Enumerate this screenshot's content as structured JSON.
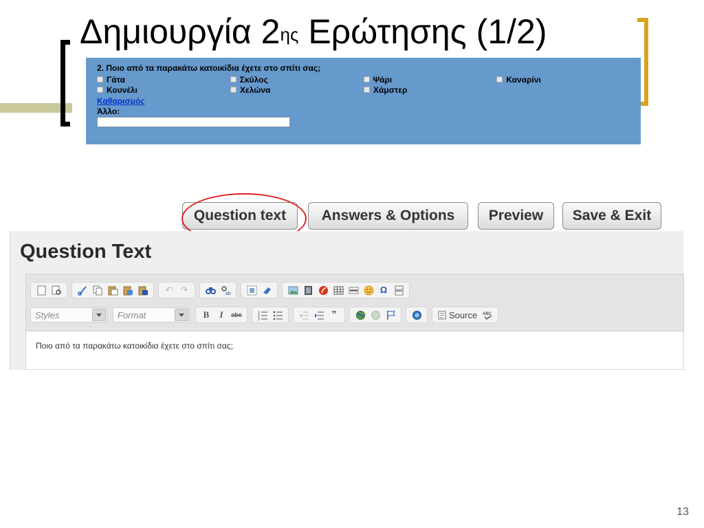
{
  "slide": {
    "title_main": "Δημιουργία 2",
    "title_sup": "ης",
    "title_rest": " Ερώτησης (1/2)",
    "page_number": "13"
  },
  "survey_preview": {
    "question": "2. Ποιο από τα παρακάτω κατοικίδια έχετε στο σπίτι σας;",
    "options_row1": [
      "Γάτα",
      "Σκύλος",
      "Ψάρι",
      "Καναρίνι"
    ],
    "options_row2": [
      "Κουνέλι",
      "Χελώνα",
      "Χάμστερ"
    ],
    "clear_link": "Καθαρισμός",
    "other_label": "Άλλο:",
    "background_color": "#6699cc"
  },
  "tabs": {
    "question_text": "Question text",
    "answers_options": "Answers & Options",
    "preview": "Preview",
    "save_exit": "Save & Exit",
    "highlighted": "Question text",
    "highlight_color": "#e01f1f"
  },
  "editor": {
    "heading": "Question Text",
    "styles_combo": "Styles",
    "format_combo": "Format",
    "source_button": "Source",
    "content": "Ποιο από τα παρακάτω κατοικίδια έχετε στο σπίτι σας;",
    "toolbar_row1_icons": [
      "new-page-icon",
      "preview-icon",
      "cut-icon",
      "copy-icon",
      "paste-icon",
      "paste-text-icon",
      "paste-word-icon",
      "undo-icon",
      "redo-icon",
      "find-icon",
      "replace-icon",
      "select-all-icon",
      "remove-format-icon",
      "image-icon",
      "flash-icon",
      "table-icon",
      "horizontal-rule-icon",
      "smiley-icon",
      "special-char-icon",
      "page-break-icon"
    ],
    "toolbar_row2_icons": [
      "bold-icon",
      "italic-icon",
      "strike-icon",
      "numbered-list-icon",
      "bulleted-list-icon",
      "outdent-icon",
      "indent-icon",
      "blockquote-icon",
      "link-icon",
      "unlink-icon",
      "anchor-icon",
      "maximize-icon",
      "source-icon",
      "spellcheck-icon"
    ]
  }
}
